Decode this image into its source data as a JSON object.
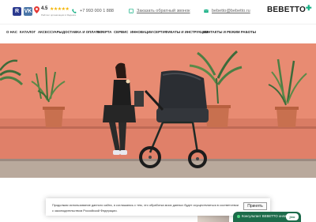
{
  "social": [
    {
      "label": "R",
      "color": "#2b3a8f"
    },
    {
      "label": "VK",
      "color": "#4a76a8"
    }
  ],
  "rating": {
    "score": "4.5",
    "stars": "★★★★★",
    "caption": "Рейтинг организации в Яндексе"
  },
  "contacts": {
    "phone": "+7 993 000 1 888",
    "callback": "Заказать обратный звонок",
    "email": "bebetto@bebetto.ru"
  },
  "logo": {
    "text": "BEBETTO",
    "mark": "✚"
  },
  "nav": [
    "О НАС",
    "КАТАЛОГ",
    "АКСЕССУАРЫ",
    "ДОСТАВКА И ОПЛАТА",
    "ОФЕРТА",
    "СЕРВИС",
    "ИННОВАЦИИ",
    "СЕРТИФИКАТЫ И ИНСТРУКЦИИ",
    "КОНТАКТЫ И РЕЖИМ РАБОТЫ"
  ],
  "cookie": {
    "text": "Продолжая использование данного сайта, я соглашаюсь с тем, что обработка моих данных будет осуществляться в соответствии с законодательством Российской Федерации.",
    "button": "Принять"
  },
  "chat": {
    "label": "Консультант BEBETTO онлайн",
    "brand": "jivo"
  },
  "colors": {
    "accent": "#16b085",
    "hero_wall": "#e4876f",
    "chat": "#1c6b4a"
  }
}
